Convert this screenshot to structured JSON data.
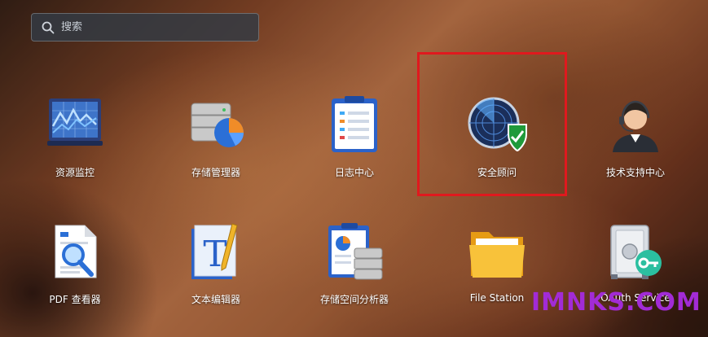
{
  "search": {
    "placeholder": "搜索"
  },
  "apps": [
    {
      "label": "资源监控",
      "icon": "resource-monitor-icon"
    },
    {
      "label": "存储管理器",
      "icon": "storage-manager-icon"
    },
    {
      "label": "日志中心",
      "icon": "log-center-icon"
    },
    {
      "label": "安全顾问",
      "icon": "security-advisor-icon",
      "highlighted": true
    },
    {
      "label": "技术支持中心",
      "icon": "support-center-icon"
    },
    {
      "label": "PDF 查看器",
      "icon": "pdf-viewer-icon"
    },
    {
      "label": "文本编辑器",
      "icon": "text-editor-icon"
    },
    {
      "label": "存储空间分析器",
      "icon": "storage-analyzer-icon"
    },
    {
      "label": "File Station",
      "icon": "file-station-icon"
    },
    {
      "label": "OAuth Service",
      "icon": "oauth-service-icon"
    }
  ],
  "colors": {
    "highlight": "#e0191e",
    "watermark": "#a22bd6"
  },
  "watermark": "IMNKS.COM"
}
